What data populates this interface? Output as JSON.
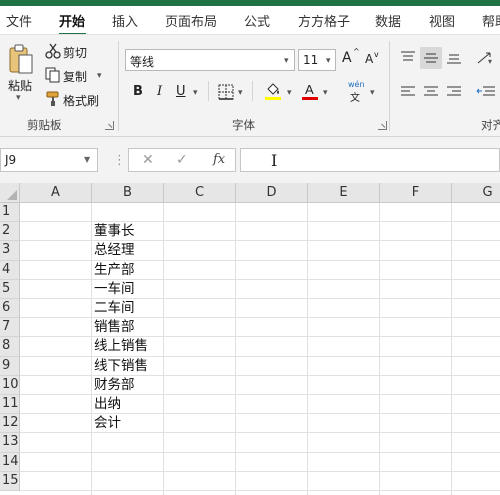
{
  "ribbon_tabs": [
    "文件",
    "开始",
    "插入",
    "页面布局",
    "公式",
    "方方格子",
    "数据",
    "视图",
    "帮助"
  ],
  "clipboard": {
    "paste_label": "粘贴",
    "cut_label": "剪切",
    "copy_label": "复制",
    "format_painter_label": "格式刷",
    "group_label": "剪贴板"
  },
  "font": {
    "font_name": "等线",
    "font_size": "11",
    "grow_label": "A",
    "shrink_label": "A",
    "bold_label": "B",
    "italic_label": "I",
    "underline_label": "U",
    "phonetic_top": "wén",
    "phonetic_bottom": "文",
    "group_label": "字体"
  },
  "alignment": {
    "group_label": "对齐"
  },
  "colors": {
    "accent": "#217346",
    "highlight": "#ffff00",
    "font_color": "#e00000"
  },
  "formula_bar": {
    "name_box": "J9",
    "fx_label": "fx",
    "formula_value": ""
  },
  "grid": {
    "columns": [
      "A",
      "B",
      "C",
      "D",
      "E",
      "F",
      "G"
    ],
    "rows": [
      "1",
      "2",
      "3",
      "4",
      "5",
      "6",
      "7",
      "8",
      "9",
      "10",
      "11",
      "12",
      "13",
      "14",
      "15"
    ],
    "column_b_values": [
      "",
      "董事长",
      "总经理",
      "生产部",
      "一车间",
      "二车间",
      "销售部",
      "线上销售",
      "线下销售",
      "财务部",
      "出纳",
      "会计",
      "",
      "",
      ""
    ]
  }
}
